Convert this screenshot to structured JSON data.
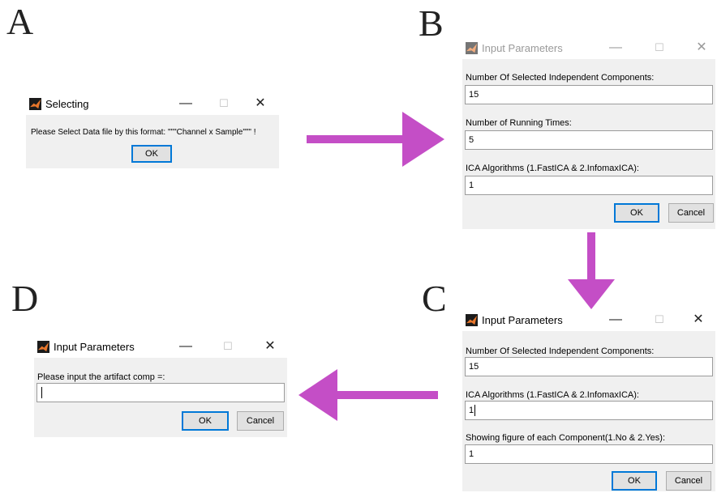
{
  "panels": {
    "a": "A",
    "b": "B",
    "c": "C",
    "d": "D"
  },
  "win_controls": {
    "minimize": "—",
    "maximize": "☐",
    "close": "✕"
  },
  "dialog_a": {
    "title": "Selecting",
    "message": "Please Select Data file by this format:  \"\"\"Channel x Sample\"\"\" !",
    "ok": "OK"
  },
  "dialog_b": {
    "title": "Input Parameters",
    "fields": [
      {
        "label": "Number Of Selected Independent Components:",
        "value": "15"
      },
      {
        "label": "Number of Running Times:",
        "value": "5"
      },
      {
        "label": "ICA Algorithms (1.FastICA & 2.InfomaxICA):",
        "value": "1"
      }
    ],
    "ok": "OK",
    "cancel": "Cancel"
  },
  "dialog_c": {
    "title": "Input Parameters",
    "fields": [
      {
        "label": "Number Of Selected Independent Components:",
        "value": "15"
      },
      {
        "label": "ICA Algorithms (1.FastICA & 2.InfomaxICA):",
        "value": "1"
      },
      {
        "label": "Showing figure of each Component(1.No & 2.Yes):",
        "value": "1"
      }
    ],
    "ok": "OK",
    "cancel": "Cancel"
  },
  "dialog_d": {
    "title": "Input Parameters",
    "fields": [
      {
        "label": "Please input the artifact comp =:",
        "value": ""
      }
    ],
    "ok": "OK",
    "cancel": "Cancel"
  },
  "colors": {
    "arrow": "#c44ec6",
    "focus_border": "#0078d7",
    "dialog_bg": "#f0f0f0"
  },
  "icons": [
    "matlab-icon"
  ]
}
